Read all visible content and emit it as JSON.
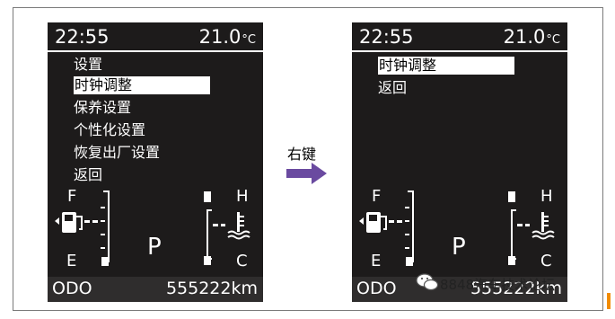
{
  "transition": {
    "label": "右键",
    "arrow_color": "#6a4aa0"
  },
  "left_screen": {
    "time": "22:55",
    "temperature": "21.0",
    "temp_unit": "°C",
    "menu_title": "设置",
    "menu_items": [
      {
        "label": "时钟调整",
        "selected": true
      },
      {
        "label": "保养设置",
        "selected": false
      },
      {
        "label": "个性化设置",
        "selected": false
      },
      {
        "label": "恢复出厂设置",
        "selected": false
      },
      {
        "label": "返回",
        "selected": false
      }
    ],
    "fuel_full": "F",
    "fuel_empty": "E",
    "coolant_hot": "H",
    "coolant_cold": "C",
    "gear": "P",
    "odo_label": "ODO",
    "odo_value": "555222km"
  },
  "right_screen": {
    "time": "22:55",
    "temperature": "21.0",
    "temp_unit": "°C",
    "menu_items": [
      {
        "label": "时钟调整",
        "selected": true
      },
      {
        "label": "返回",
        "selected": false
      }
    ],
    "fuel_full": "F",
    "fuel_empty": "E",
    "coolant_hot": "H",
    "coolant_cold": "C",
    "gear": "P",
    "odo_label": "ODO",
    "odo_value": "555222km"
  },
  "watermark": {
    "text": "8848汽车技术论坛",
    "icon": "wechat-icon"
  }
}
